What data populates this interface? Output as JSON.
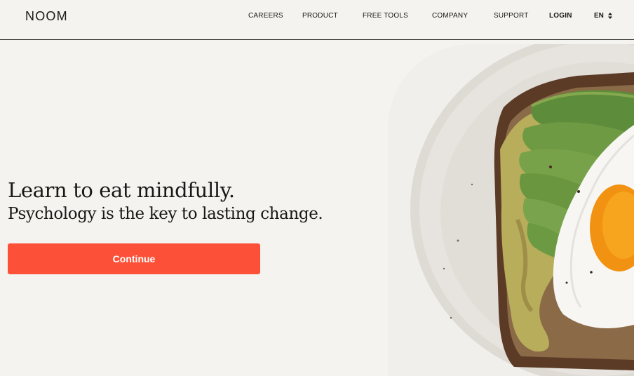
{
  "header": {
    "logo": "NOOM",
    "nav": [
      {
        "label": "CAREERS"
      },
      {
        "label": "PRODUCT"
      },
      {
        "label": "FREE TOOLS"
      },
      {
        "label": "COMPANY"
      },
      {
        "label": "SUPPORT"
      },
      {
        "label": "LOGIN"
      }
    ],
    "language": "EN"
  },
  "hero": {
    "headline": "Learn to eat mindfully.",
    "subheadline": "Psychology is the key to lasting change.",
    "cta_label": "Continue",
    "image": "avocado-toast-with-fried-egg"
  },
  "colors": {
    "background": "#f4f3ef",
    "cta": "#fc5138",
    "text": "#191717"
  }
}
